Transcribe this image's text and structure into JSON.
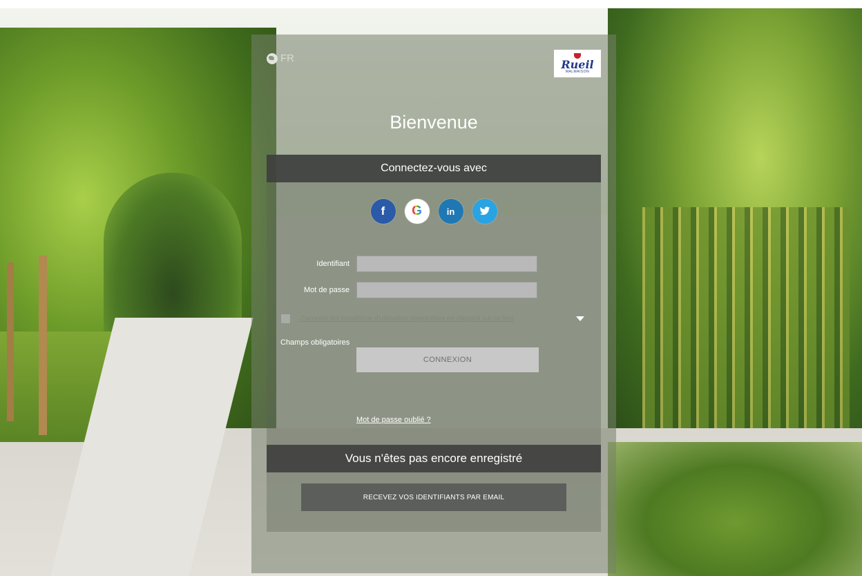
{
  "language": {
    "code": "FR",
    "icon": "globe-icon"
  },
  "logo": {
    "name": "Rueil",
    "subtitle": "MALMAISON"
  },
  "page_title": "Bienvenue",
  "login": {
    "header": "Connectez-vous avec",
    "social_providers": [
      {
        "name": "facebook",
        "glyph": "f",
        "color": "#2a5aa8"
      },
      {
        "name": "google",
        "glyph": "G",
        "color": "#ffffff"
      },
      {
        "name": "linkedin",
        "glyph": "in",
        "color": "#1f78b4"
      },
      {
        "name": "twitter",
        "glyph": "twitter-bird",
        "color": "#2aa3e3"
      }
    ],
    "identifier_label": "Identifiant",
    "identifier_value": "",
    "password_label": "Mot de passe",
    "password_value": "",
    "terms_text": "J'accepte les conditions d'utilisation disponibles en cliquant sur ce lien",
    "terms_checked": false,
    "required_note": "Champs obligatoires",
    "submit_label": "CONNEXION",
    "forgot_label": "Mot de passe oublié ?"
  },
  "register": {
    "header": "Vous n'êtes pas encore enregistré",
    "button_label": "RECEVEZ VOS IDENTIFIANTS PAR EMAIL"
  }
}
